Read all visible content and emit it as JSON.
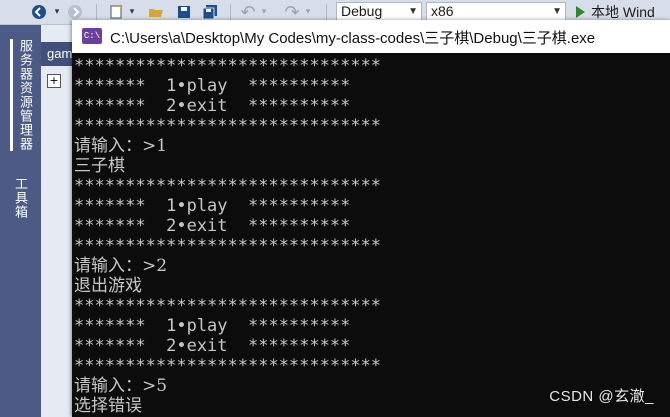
{
  "toolbar": {
    "back_icon": "back-arrow-icon",
    "forward_icon": "forward-arrow-icon",
    "new_item_icon": "new-item-icon",
    "open_icon": "open-folder-icon",
    "save_icon": "save-icon",
    "save_all_icon": "save-all-icon",
    "undo_icon": "undo-icon",
    "redo_icon": "redo-icon",
    "config_value": "Debug",
    "platform_value": "x86",
    "run_label": "本地 Wind"
  },
  "sidebar": {
    "tabs": [
      {
        "label": "服务器资源管理器"
      },
      {
        "label": "工具箱"
      }
    ]
  },
  "editor": {
    "doc_tab_label": "gam",
    "expand_symbol": "+"
  },
  "console": {
    "title": "C:\\Users\\a\\Desktop\\My Codes\\my-class-codes\\三子棋\\Debug\\三子棋.exe",
    "lines": [
      "******************************",
      "*******  1•play  **********",
      "*******  2•exit  **********",
      "******************************",
      "请输入：>1",
      "三子棋",
      "******************************",
      "*******  1•play  **********",
      "*******  2•exit  **********",
      "******************************",
      "请输入：>2",
      "退出游戏",
      "******************************",
      "*******  1•play  **********",
      "*******  2•exit  **********",
      "******************************",
      "请输入：>5",
      "选择错误"
    ]
  },
  "watermark": "CSDN @玄澈_"
}
